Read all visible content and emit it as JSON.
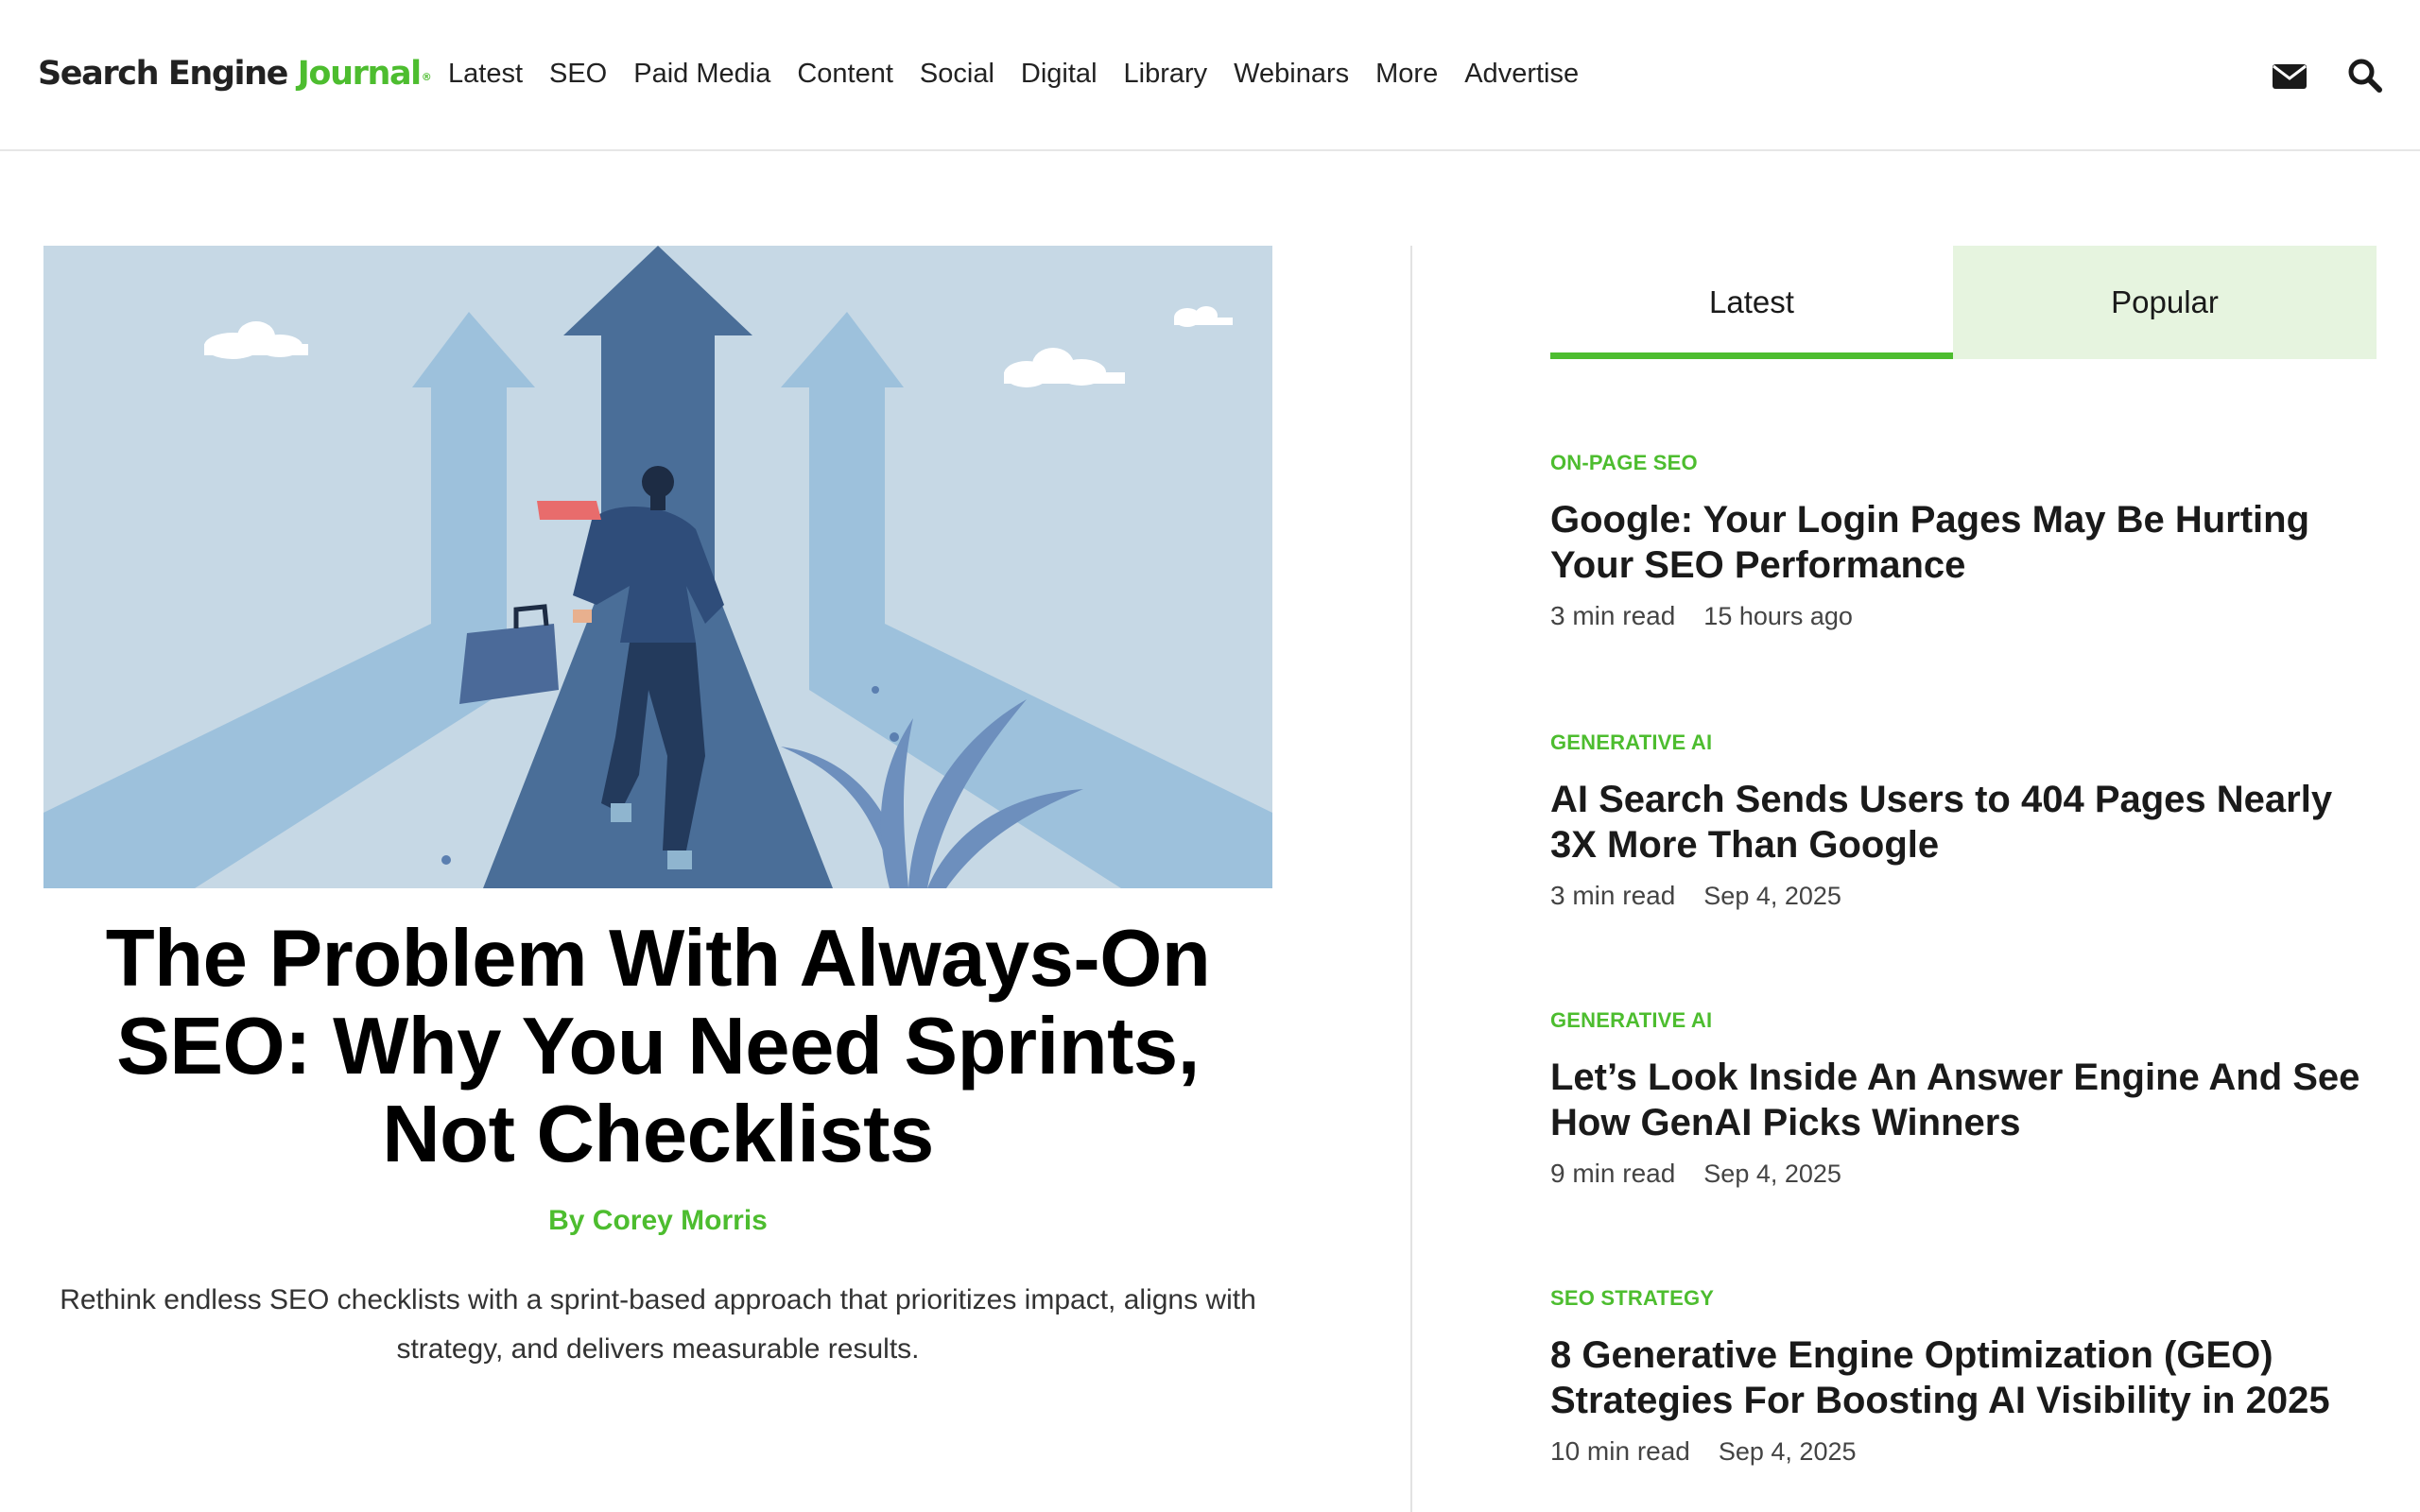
{
  "header": {
    "logo": {
      "part1": "Search Engine ",
      "part2": "Journal",
      "reg": "®"
    },
    "nav": [
      "Latest",
      "SEO",
      "Paid Media",
      "Content",
      "Social",
      "Digital",
      "Library",
      "Webinars",
      "More",
      "Advertise"
    ],
    "icons": [
      "envelope-icon",
      "search-icon"
    ]
  },
  "featured": {
    "image_icon": "businessman-running-toward-arrows-illustration",
    "title": "The Problem With Always-On SEO: Why You Need Sprints, Not Checklists",
    "author": "By Corey Morris",
    "excerpt": "Rethink endless SEO checklists with a sprint-based approach that prioritizes impact, aligns with strategy, and delivers measurable results."
  },
  "sidebar": {
    "tabs": [
      "Latest",
      "Popular"
    ],
    "active_tab": "Latest",
    "articles": [
      {
        "category": "ON-PAGE SEO",
        "title": "Google: Your Login Pages May Be Hurting Your SEO Performance",
        "read_time": "3 min read",
        "date": "15 hours ago"
      },
      {
        "category": "GENERATIVE AI",
        "title": "AI Search Sends Users to 404 Pages Nearly 3X More Than Google",
        "read_time": "3 min read",
        "date": "Sep 4, 2025"
      },
      {
        "category": "GENERATIVE AI",
        "title": "Let’s Look Inside An Answer Engine And See How GenAI Picks Winners",
        "read_time": "9 min read",
        "date": "Sep 4, 2025"
      },
      {
        "category": "SEO STRATEGY",
        "title": "8 Generative Engine Optimization (GEO) Strategies For Boosting AI Visibility in 2025",
        "read_time": "10 min read",
        "date": "Sep 4, 2025"
      }
    ]
  },
  "colors": {
    "accent": "#4dbd2f",
    "tab_inactive_bg": "#e6f4df",
    "text": "#1a1a1a"
  }
}
